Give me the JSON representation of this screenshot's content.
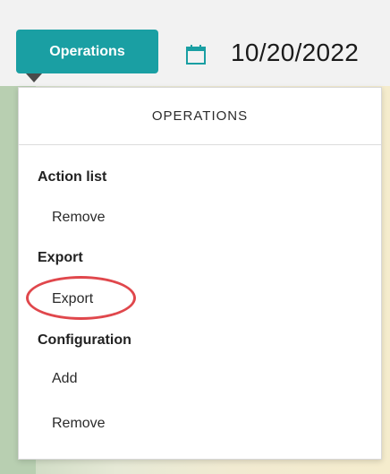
{
  "toolbar": {
    "operations_label": "Operations",
    "date": "10/20/2022"
  },
  "dropdown": {
    "header": "OPERATIONS",
    "sections": [
      {
        "title": "Action list",
        "items": [
          "Remove"
        ]
      },
      {
        "title": "Export",
        "items": [
          "Export"
        ]
      },
      {
        "title": "Configuration",
        "items": [
          "Add",
          "Remove"
        ]
      }
    ]
  },
  "colors": {
    "accent": "#1a9fa3",
    "highlight": "#e0474c"
  },
  "icons": {
    "calendar": "calendar-icon",
    "caret": "caret-down-icon"
  }
}
